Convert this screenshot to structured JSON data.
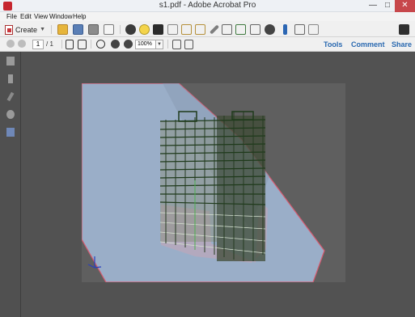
{
  "window": {
    "title": "s1.pdf - Adobe Acrobat Pro",
    "minimize": "—",
    "maximize": "□",
    "close": "✕"
  },
  "menu": {
    "file": "File",
    "edit": "Edit",
    "view": "View",
    "window": "Window",
    "help": "Help"
  },
  "toolbar": {
    "create_label": "Create"
  },
  "navigation": {
    "current_page": "1",
    "page_total": "/ 1",
    "zoom": "100%"
  },
  "links": {
    "tools": "Tools",
    "comment": "Comment",
    "share": "Share"
  },
  "colors": {
    "close_button": "#c7474b",
    "link": "#2a69b0",
    "viewport_background": "#9aaec8",
    "highlight_edge": "#d75a6f",
    "structure_dark": "#1e3a1a",
    "structure_light": "#d7e4d2"
  }
}
